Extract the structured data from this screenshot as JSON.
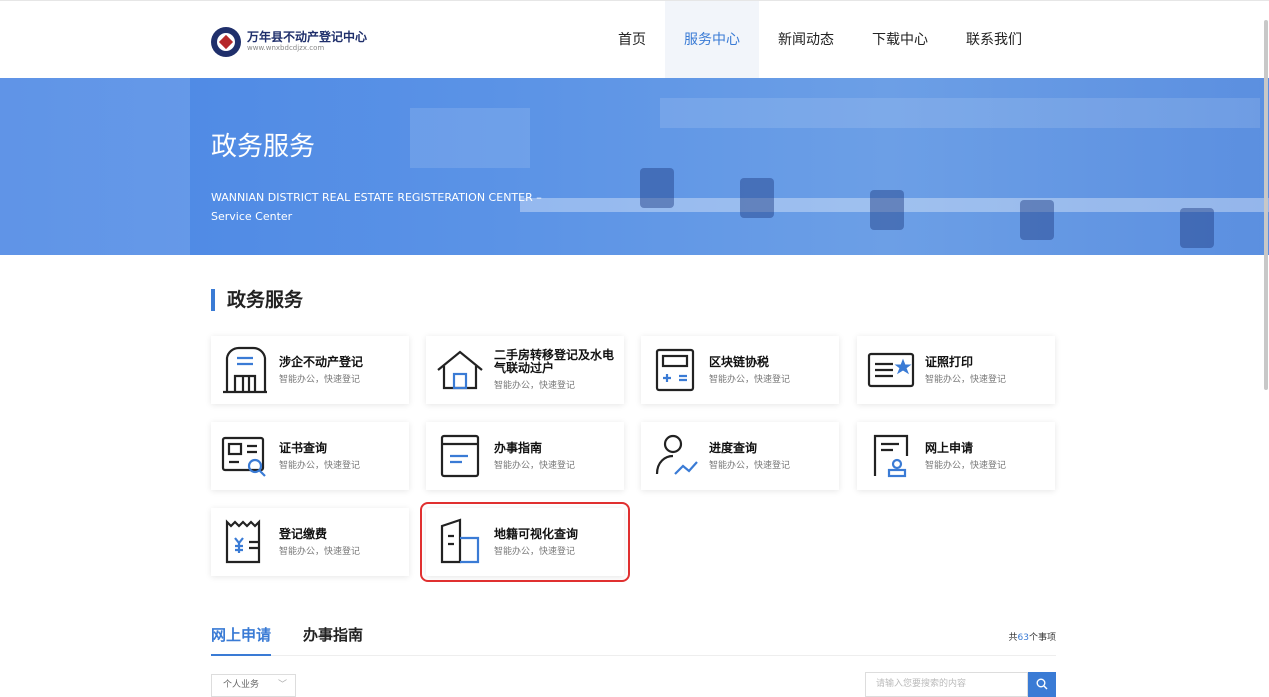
{
  "header": {
    "logo_title": "万年县不动产登记中心",
    "logo_sub": "www.wnxbdcdjzx.com",
    "nav": [
      "首页",
      "服务中心",
      "新闻动态",
      "下载中心",
      "联系我们"
    ],
    "active_nav": "服务中心"
  },
  "banner": {
    "title": "政务服务",
    "subtitle": "WANNIAN DISTRICT REAL ESTATE REGISTERATION CENTER – Service Center"
  },
  "section_title": "政务服务",
  "cards": [
    {
      "title": "涉企不动产登记",
      "desc": "智能办公，快速登记",
      "icon": "building-icon"
    },
    {
      "title": "二手房转移登记及水电气联动过户",
      "desc": "智能办公，快速登记",
      "icon": "house-icon"
    },
    {
      "title": "区块链协税",
      "desc": "智能办公，快速登记",
      "icon": "calculator-icon"
    },
    {
      "title": "证照打印",
      "desc": "智能办公，快速登记",
      "icon": "certificate-icon"
    },
    {
      "title": "证书查询",
      "desc": "智能办公，快速登记",
      "icon": "search-doc-icon"
    },
    {
      "title": "办事指南",
      "desc": "智能办公，快速登记",
      "icon": "guide-book-icon"
    },
    {
      "title": "进度查询",
      "desc": "智能办公，快速登记",
      "icon": "progress-icon"
    },
    {
      "title": "网上申请",
      "desc": "智能办公，快速登记",
      "icon": "online-apply-icon"
    },
    {
      "title": "登记缴费",
      "desc": "智能办公，快速登记",
      "icon": "payment-icon"
    },
    {
      "title": "地籍可视化查询",
      "desc": "智能办公，快速登记",
      "icon": "map-visual-icon"
    }
  ],
  "tabs": {
    "items": [
      "网上申请",
      "办事指南"
    ],
    "active": "网上申请",
    "count_prefix": "共",
    "count": "63",
    "count_suffix": "个事项"
  },
  "filter": {
    "select_value": "个人业务",
    "search_placeholder": "请输入您要搜索的内容"
  },
  "colors": {
    "accent": "#3a7bd5",
    "highlight": "#e03030"
  }
}
